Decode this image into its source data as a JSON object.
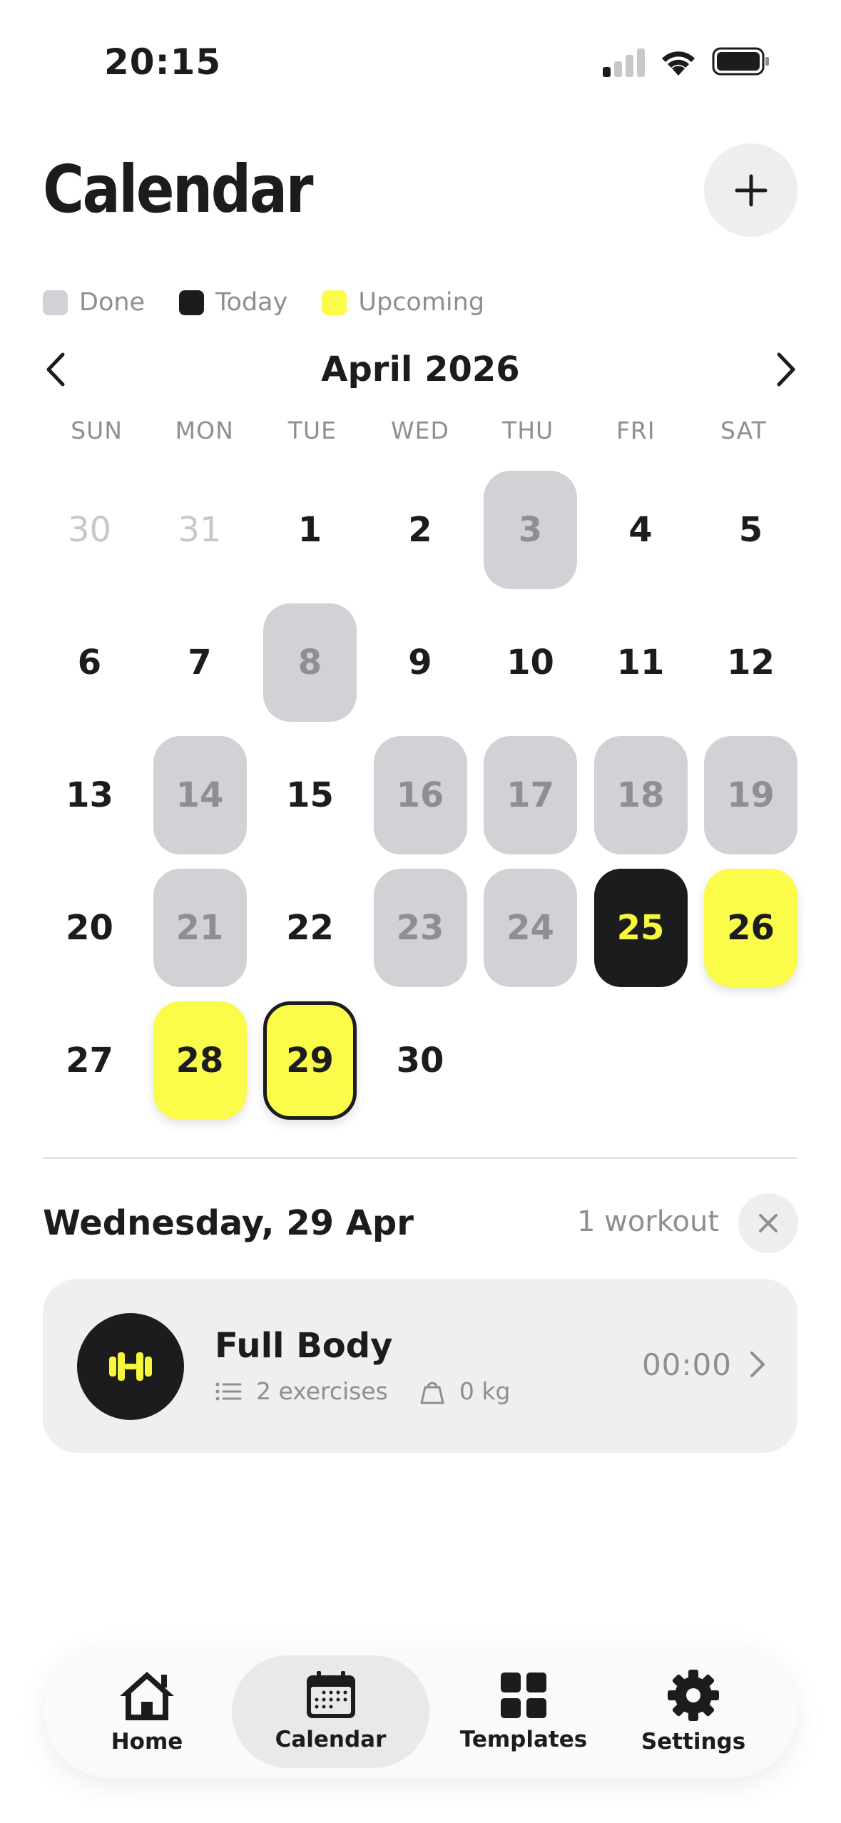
{
  "status_bar": {
    "time": "20:15"
  },
  "header": {
    "title": "Calendar",
    "add_icon": "plus-icon"
  },
  "legend": [
    {
      "label": "Done",
      "color": "#d1d1d6"
    },
    {
      "label": "Today",
      "color": "#1c1c1e"
    },
    {
      "label": "Upcoming",
      "color": "#fbfb4a"
    }
  ],
  "calendar": {
    "month_label": "April 2026",
    "weekdays": [
      "SUN",
      "MON",
      "TUE",
      "WED",
      "THU",
      "FRI",
      "SAT"
    ],
    "days": [
      {
        "n": "30",
        "state": "outside"
      },
      {
        "n": "31",
        "state": "outside"
      },
      {
        "n": "1",
        "state": "none"
      },
      {
        "n": "2",
        "state": "none"
      },
      {
        "n": "3",
        "state": "done"
      },
      {
        "n": "4",
        "state": "none"
      },
      {
        "n": "5",
        "state": "none"
      },
      {
        "n": "6",
        "state": "none"
      },
      {
        "n": "7",
        "state": "none"
      },
      {
        "n": "8",
        "state": "done"
      },
      {
        "n": "9",
        "state": "none"
      },
      {
        "n": "10",
        "state": "none"
      },
      {
        "n": "11",
        "state": "none"
      },
      {
        "n": "12",
        "state": "none"
      },
      {
        "n": "13",
        "state": "none"
      },
      {
        "n": "14",
        "state": "done"
      },
      {
        "n": "15",
        "state": "none"
      },
      {
        "n": "16",
        "state": "done"
      },
      {
        "n": "17",
        "state": "done"
      },
      {
        "n": "18",
        "state": "done"
      },
      {
        "n": "19",
        "state": "done"
      },
      {
        "n": "20",
        "state": "none"
      },
      {
        "n": "21",
        "state": "done"
      },
      {
        "n": "22",
        "state": "none"
      },
      {
        "n": "23",
        "state": "done"
      },
      {
        "n": "24",
        "state": "done"
      },
      {
        "n": "25",
        "state": "today"
      },
      {
        "n": "26",
        "state": "upcoming"
      },
      {
        "n": "27",
        "state": "none"
      },
      {
        "n": "28",
        "state": "upcoming"
      },
      {
        "n": "29",
        "state": "upcoming",
        "selected": true
      },
      {
        "n": "30",
        "state": "none"
      }
    ]
  },
  "selected_day": {
    "date_label": "Wednesday, 29 Apr",
    "count_label": "1 workout",
    "workout": {
      "name": "Full Body",
      "exercises": "2 exercises",
      "weight": "0 kg",
      "duration": "00:00",
      "icon": "dumbbell-icon"
    }
  },
  "tabbar": [
    {
      "label": "Home",
      "icon": "home-icon",
      "active": false
    },
    {
      "label": "Calendar",
      "icon": "calendar-icon",
      "active": true
    },
    {
      "label": "Templates",
      "icon": "grid-icon",
      "active": false
    },
    {
      "label": "Settings",
      "icon": "gear-icon",
      "active": false
    }
  ]
}
